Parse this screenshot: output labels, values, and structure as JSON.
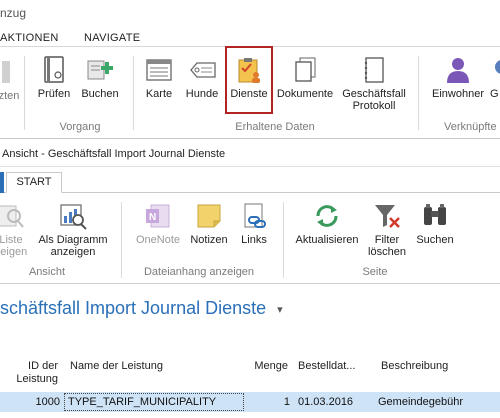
{
  "window1": {
    "title_fragment": "nzug",
    "tabs": [
      "AKTIONEN",
      "NAVIGATE"
    ],
    "buttons": {
      "partial_left": "zten",
      "pruefen": "Prüfen",
      "buchen": "Buchen",
      "karte": "Karte",
      "hunde": "Hunde",
      "dienste": "Dienste",
      "dokumente": "Dokumente",
      "protokoll": "Geschäftsfall Protokoll",
      "einwohner": "Einwohner",
      "partial_right": "G"
    },
    "groups": {
      "vorgang": "Vorgang",
      "erhaltene_daten": "Erhaltene Daten",
      "verknuepft": "Verknüpfte"
    }
  },
  "window2": {
    "title": "Ansicht - Geschäftsfall Import Journal Dienste",
    "tab": "START",
    "buttons": {
      "liste": "Liste zeigen",
      "diagramm": "Als Diagramm anzeigen",
      "onenote": "OneNote",
      "notizen": "Notizen",
      "links": "Links",
      "aktualisieren": "Aktualisieren",
      "filter": "Filter löschen",
      "suchen": "Suchen"
    },
    "groups": {
      "ansicht": "Ansicht",
      "dateianhang": "Dateianhang anzeigen",
      "seite": "Seite"
    },
    "page_title": "schäftsfall Import Journal Dienste",
    "dropdown_glyph": "▾",
    "table": {
      "headers": {
        "id": "ID der Leistung",
        "name": "Name der Leistung",
        "menge": "Menge",
        "bestell": "Bestelldat...",
        "beschreibung": "Beschreibung"
      },
      "rows": [
        {
          "id": "1000",
          "name": "TYPE_TARIF_MUNICIPALITY",
          "menge": "1",
          "bestell": "01.03.2016",
          "beschreibung": "Gemeindegebühr"
        }
      ]
    }
  },
  "colors": {
    "accent_blue": "#2a6fb8",
    "highlight_red": "#b32424",
    "selected_row": "#cfe3f6",
    "ribbon_bg": "#ffffff"
  }
}
